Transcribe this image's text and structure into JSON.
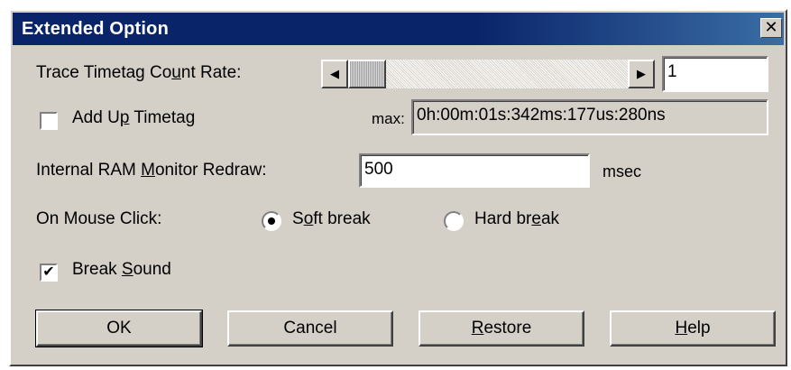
{
  "window": {
    "title": "Extended Option",
    "close_symbol": "✕"
  },
  "trace": {
    "label_before": "Trace Timetag Co",
    "label_mnemonic": "u",
    "label_after": "nt Rate:",
    "scroll_left_icon": "◀",
    "scroll_right_icon": "▶",
    "value": "1"
  },
  "add_up": {
    "checked": false,
    "label_before": "Add U",
    "label_mnemonic": "p",
    "label_after": " Timetag",
    "max_label": "max:",
    "max_value": "0h:00m:01s:342ms:177us:280ns"
  },
  "ram_monitor": {
    "label_before": "Internal RAM ",
    "label_mnemonic": "M",
    "label_after": "onitor Redraw:",
    "value": "500",
    "unit": "msec"
  },
  "mouse_click": {
    "label": "On Mouse Click:",
    "soft_break": {
      "selected": true,
      "label_before": "S",
      "label_mnemonic": "o",
      "label_after": "ft break"
    },
    "hard_break": {
      "selected": false,
      "label_before": "Hard br",
      "label_mnemonic": "e",
      "label_after": "ak"
    }
  },
  "break_sound": {
    "checked": true,
    "check_symbol": "✔",
    "label_before": "Break ",
    "label_mnemonic": "S",
    "label_after": "ound"
  },
  "buttons": {
    "ok": "OK",
    "cancel": "Cancel",
    "restore_mnemonic": "R",
    "restore_rest": "estore",
    "help_mnemonic": "H",
    "help_rest": "elp"
  }
}
